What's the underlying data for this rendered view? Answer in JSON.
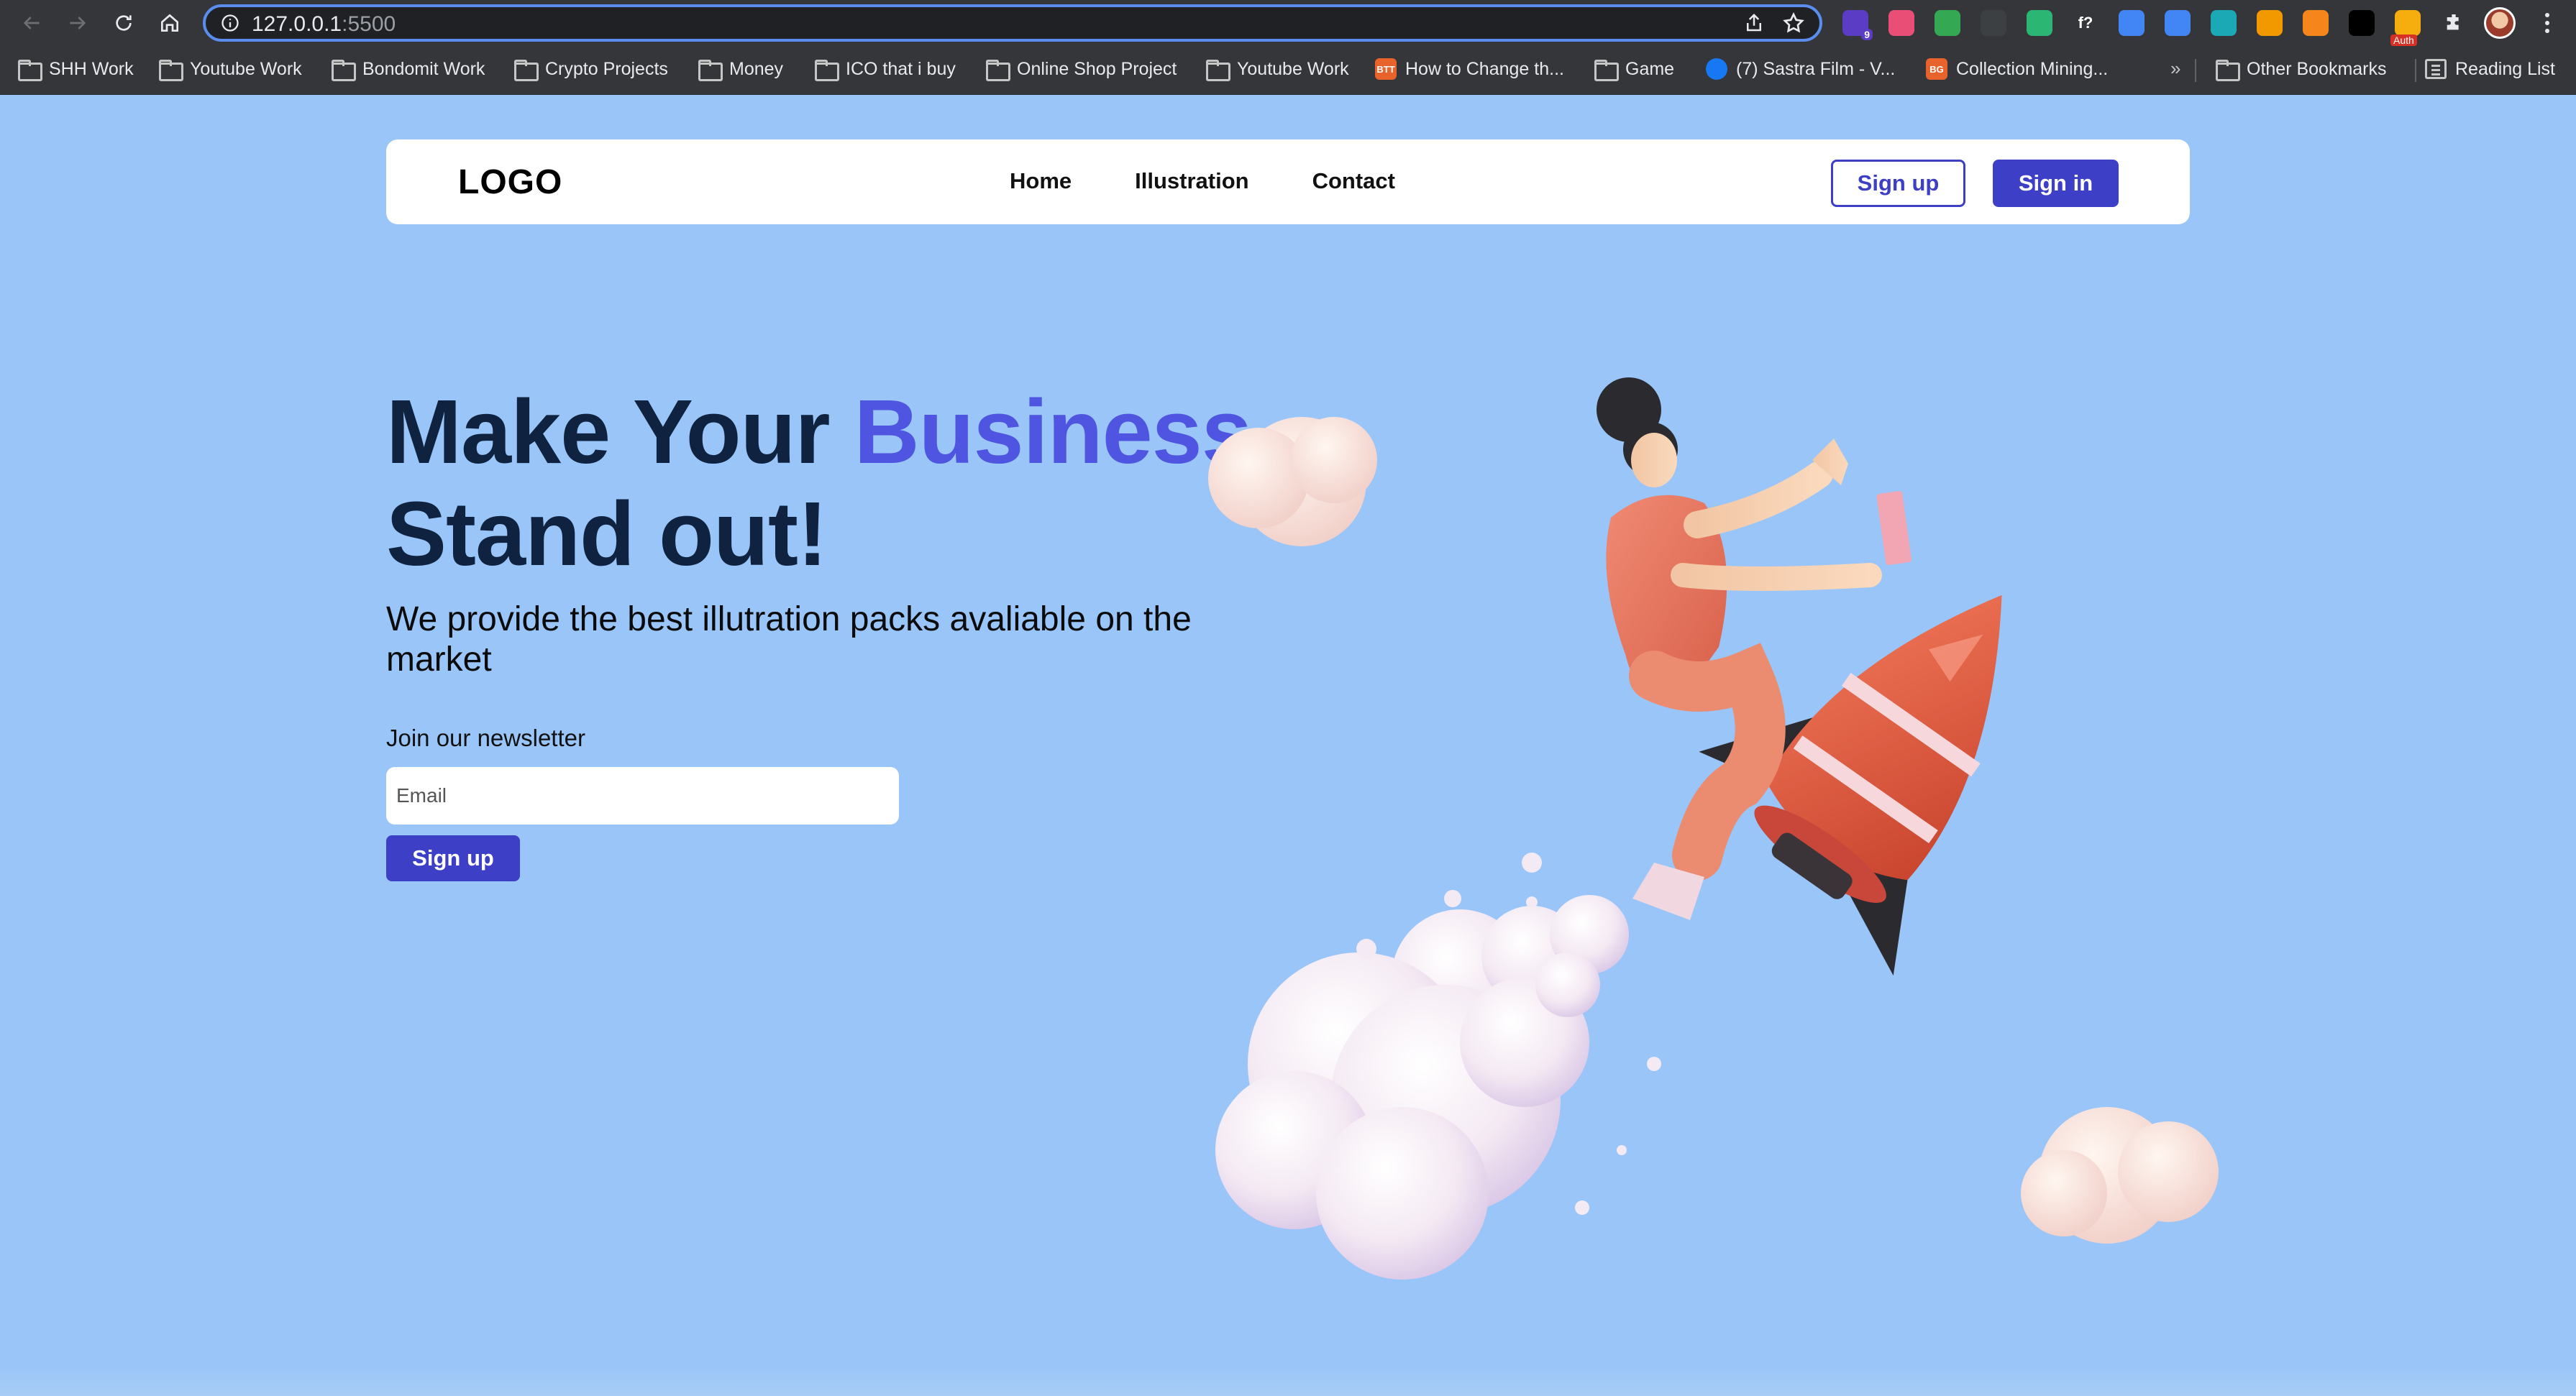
{
  "browser": {
    "url_host": "127.0.0.1",
    "url_port": ":5500",
    "extensions": [
      {
        "name": "extension-puzzle-badge",
        "badge": "9",
        "color": "#5b3cc4"
      },
      {
        "name": "extension-color-wheel",
        "color": "#e94e77"
      },
      {
        "name": "extension-green-dot",
        "color": "#34a853"
      },
      {
        "name": "extension-grid",
        "color": "#3c4043"
      },
      {
        "name": "extension-bird",
        "color": "#2bb673"
      },
      {
        "name": "extension-fx",
        "label": "f?",
        "color": "#35363a"
      },
      {
        "name": "extension-play",
        "color": "#4285f4"
      },
      {
        "name": "extension-translate",
        "color": "#4285f4"
      },
      {
        "name": "extension-diamond",
        "color": "#1aa9b5"
      },
      {
        "name": "extension-hammer",
        "color": "#f29900"
      },
      {
        "name": "extension-fox",
        "color": "#f6851b"
      },
      {
        "name": "extension-mountain",
        "color": "#000000"
      },
      {
        "name": "extension-auth",
        "badge": "Auth",
        "color": "#f6ad0e"
      }
    ]
  },
  "bookmarks": {
    "items": [
      {
        "label": "SHH Work",
        "icon": "folder-icon"
      },
      {
        "label": "Youtube Work",
        "icon": "folder-icon"
      },
      {
        "label": "Bondomit Work",
        "icon": "folder-icon"
      },
      {
        "label": "Crypto Projects",
        "icon": "folder-icon"
      },
      {
        "label": "Money",
        "icon": "folder-icon"
      },
      {
        "label": "ICO that i buy",
        "icon": "folder-icon"
      },
      {
        "label": "Online Shop Project",
        "icon": "folder-icon"
      },
      {
        "label": "Youtube Work",
        "icon": "folder-icon"
      },
      {
        "label": "How to Change th...",
        "icon": "site-favicon",
        "badge": "BTT",
        "color": "#e8632b"
      },
      {
        "label": "Game",
        "icon": "folder-icon"
      },
      {
        "label": "(7) Sastra Film - V...",
        "icon": "facebook-icon",
        "color": "#1877f2"
      },
      {
        "label": "Collection Mining...",
        "icon": "site-favicon",
        "badge": "BG",
        "color": "#e8632b"
      }
    ],
    "more": "»",
    "other": "Other Bookmarks",
    "reading_list": "Reading List"
  },
  "navbar": {
    "logo": "LOGO",
    "links": [
      "Home",
      "Illustration",
      "Contact"
    ],
    "signup": "Sign up",
    "signin": "Sign in"
  },
  "hero": {
    "title_part1": "Make Your ",
    "title_accent": "Business",
    "title_part2": "Stand out!",
    "subtitle": "We provide the best illutration packs avaliable on the market",
    "newsletter_label": "Join our newsletter",
    "email_placeholder": "Email",
    "signup_button": "Sign up"
  },
  "colors": {
    "page_background": "#99c5f8",
    "primary": "#3d3fc7",
    "accent_text": "#4f55e0",
    "heading": "#0f2240",
    "rocket": "#e2553a",
    "shirt": "#e8735c"
  }
}
